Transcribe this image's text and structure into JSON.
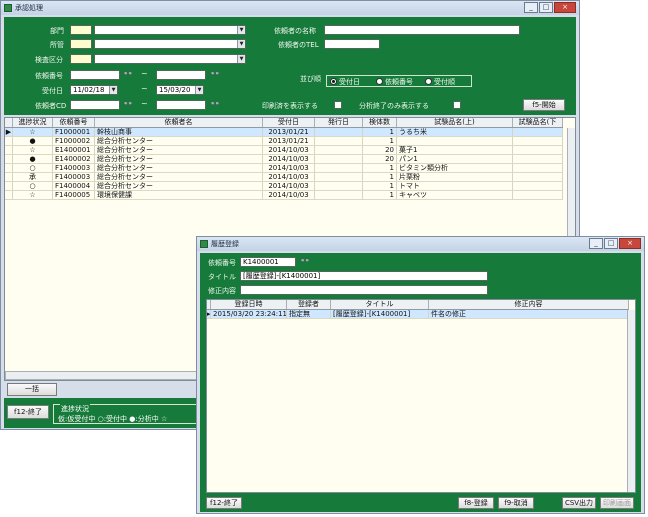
{
  "main": {
    "title": "承認処理",
    "filters": {
      "bumon_label": "部門",
      "shokan_label": "所管",
      "kensa_label": "検査区分",
      "irai_no_label": "依頼番号",
      "uketsuke_label": "受付日",
      "uketsuke_from": "11/02/18",
      "uketsuke_to": "15/03/20",
      "iraisha_cd_label": "依頼者CD",
      "tilde": "~",
      "iraisha_name_label": "依頼者の名称",
      "iraisha_tel_label": "依頼者のTEL",
      "sort_label": "並び順",
      "sort_options": [
        "受付日",
        "依頼番号",
        "受付順"
      ],
      "print_label": "印刷済を表示する",
      "analysis_label": "分析終了のみ表示する",
      "start_button": "f5-開始"
    },
    "table": {
      "headers": [
        "進捗状況",
        "依頼番号",
        "依頼者名",
        "受付日",
        "発行日",
        "検体数",
        "試験品名(上)",
        "試験品名(下"
      ],
      "rows": [
        {
          "status": "☆",
          "id": "F1000001",
          "name": "幹枝山商事",
          "date": "2013/01/21",
          "issued": "",
          "count": "1",
          "item": "うるち米"
        },
        {
          "status": "●",
          "id": "F1000002",
          "name": "総合分析センター",
          "date": "2013/01/21",
          "issued": "",
          "count": "1",
          "item": ""
        },
        {
          "status": "☆",
          "id": "E1400001",
          "name": "総合分析センター",
          "date": "2014/10/03",
          "issued": "",
          "count": "20",
          "item": "菓子1"
        },
        {
          "status": "●",
          "id": "E1400002",
          "name": "総合分析センター",
          "date": "2014/10/03",
          "issued": "",
          "count": "20",
          "item": "パン1"
        },
        {
          "status": "○",
          "id": "F1400003",
          "name": "総合分析センター",
          "date": "2014/10/03",
          "issued": "",
          "count": "1",
          "item": "ビタミン類分析"
        },
        {
          "status": "承",
          "id": "F1400003",
          "name": "総合分析センター",
          "date": "2014/10/03",
          "issued": "",
          "count": "1",
          "item": "片栗粉"
        },
        {
          "status": "○",
          "id": "F1400004",
          "name": "総合分析センター",
          "date": "2014/10/03",
          "issued": "",
          "count": "1",
          "item": "トマト"
        },
        {
          "status": "☆",
          "id": "F1400005",
          "name": "環境保健課",
          "date": "2014/10/03",
          "issued": "",
          "count": "1",
          "item": "キャベツ"
        }
      ]
    },
    "bulk_button": "一括",
    "exit_button": "f12-終了",
    "status_legend_title": "進捗状況",
    "status_legend": "仮:仮受付中 ○:受付中 ●:分析中 ☆"
  },
  "dialog": {
    "title": "履歴登録",
    "irai_no_label": "依頼番号",
    "irai_no_value": "K1400001",
    "title_label": "タイトル",
    "title_value": "[履歴登録]-[K1400001]",
    "shusei_label": "修正内容",
    "shusei_value": "",
    "table": {
      "headers": [
        "登録日時",
        "登録者",
        "タイトル",
        "修正内容"
      ],
      "rows": [
        {
          "datetime": "2015/03/20 23:24:11",
          "user": "指定無",
          "title": "[履歴登録]-[K1400001]",
          "content": "件名の修正"
        }
      ]
    },
    "exit_button": "f12-終了",
    "register_button": "f8-登録",
    "cancel_button": "f9-取消",
    "csv_button": "CSV出力",
    "print_button": "印刷画面"
  }
}
